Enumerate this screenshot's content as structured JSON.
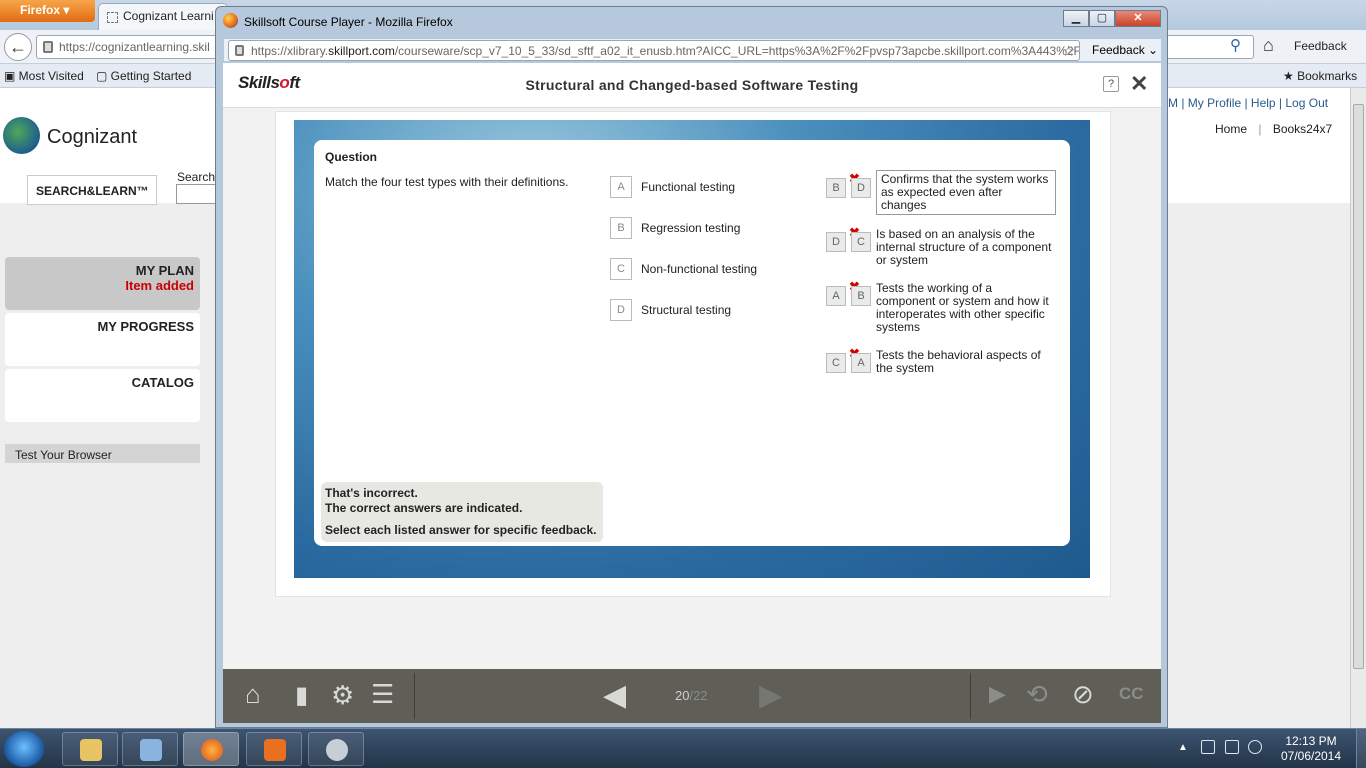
{
  "background_browser": {
    "firefox_menu": "Firefox",
    "tab_title": "Cognizant Learni",
    "url": "https://cognizantlearning.skil",
    "feedback": "Feedback",
    "bookmarks_bar": {
      "most_visited": "Most Visited",
      "getting_started": "Getting Started",
      "bookmarks": "Bookmarks"
    }
  },
  "site": {
    "brand": "Cognizant",
    "top_links": "M | My Profile | Help | Log Out",
    "home": "Home",
    "books": "Books24x7",
    "search_learn": "SEARCH&LEARN™",
    "search_label": "Search",
    "nav": {
      "my_plan": "MY PLAN",
      "item_added": "Item added",
      "my_progress": "MY PROGRESS",
      "catalog": "CATALOG"
    },
    "test_browser": "Test Your Browser"
  },
  "popup": {
    "window_title": "Skillsoft Course Player - Mozilla Firefox",
    "url_prefix": "https://xlibrary.",
    "url_domain": "skillport.com",
    "url_rest": "/courseware/scp_v7_10_5_33/sd_sftf_a02_it_enusb.htm?AICC_URL=https%3A%2F%2Fpvsp73apcbe.skillport.com%3A443%2F",
    "feedback": "Feedback"
  },
  "player": {
    "logo_text_1": "Skills",
    "logo_text_o": "o",
    "logo_text_2": "ft",
    "course_title": "Structural and Changed-based Software Testing",
    "help": "?",
    "question_heading": "Question",
    "prompt": "Match the four test types with their definitions.",
    "terms": [
      {
        "letter": "A",
        "label": "Functional testing"
      },
      {
        "letter": "B",
        "label": "Regression testing"
      },
      {
        "letter": "C",
        "label": "Non-functional testing"
      },
      {
        "letter": "D",
        "label": "Structural testing"
      }
    ],
    "matches": [
      {
        "selected": "B",
        "correct": "D",
        "definition": "Confirms that the system works as expected even after changes"
      },
      {
        "selected": "D",
        "correct": "C",
        "definition": "Is based on an analysis of the internal structure of a component or system"
      },
      {
        "selected": "A",
        "correct": "B",
        "definition": "Tests the working of a component or system and how it interoperates with other specific systems"
      },
      {
        "selected": "C",
        "correct": "A",
        "definition": "Tests the behavioral aspects of the system"
      }
    ],
    "feedback": {
      "line1": "That's incorrect.",
      "line2": "The correct answers are indicated.",
      "line3": "Select each listed answer for specific feedback."
    },
    "page_current": "20",
    "page_total": "/22",
    "cc": "CC"
  },
  "taskbar": {
    "time": "12:13 PM",
    "date": "07/06/2014"
  }
}
